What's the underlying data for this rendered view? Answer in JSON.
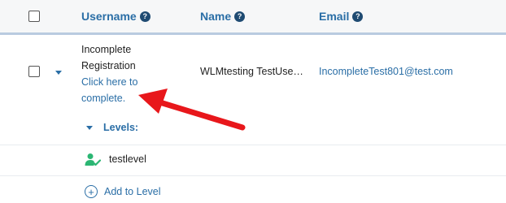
{
  "header": {
    "username_label": "Username",
    "name_label": "Name",
    "email_label": "Email",
    "help_glyph": "?"
  },
  "row": {
    "username_status_line1": "Incomplete",
    "username_status_line2": "Registration",
    "complete_link_line1": "Click here to",
    "complete_link_line2": "complete.",
    "name": "WLMtesting TestUse…",
    "email": "IncompleteTest801@test.com"
  },
  "levels": {
    "label": "Levels:",
    "items": [
      {
        "name": "testlevel",
        "icon": "user-check-icon"
      }
    ],
    "add_label": "Add to Level"
  },
  "colors": {
    "accent": "#2a6ea6",
    "header_border": "#b9cbe0",
    "icon_green": "#2bb673",
    "annotation_red": "#e8171b"
  }
}
